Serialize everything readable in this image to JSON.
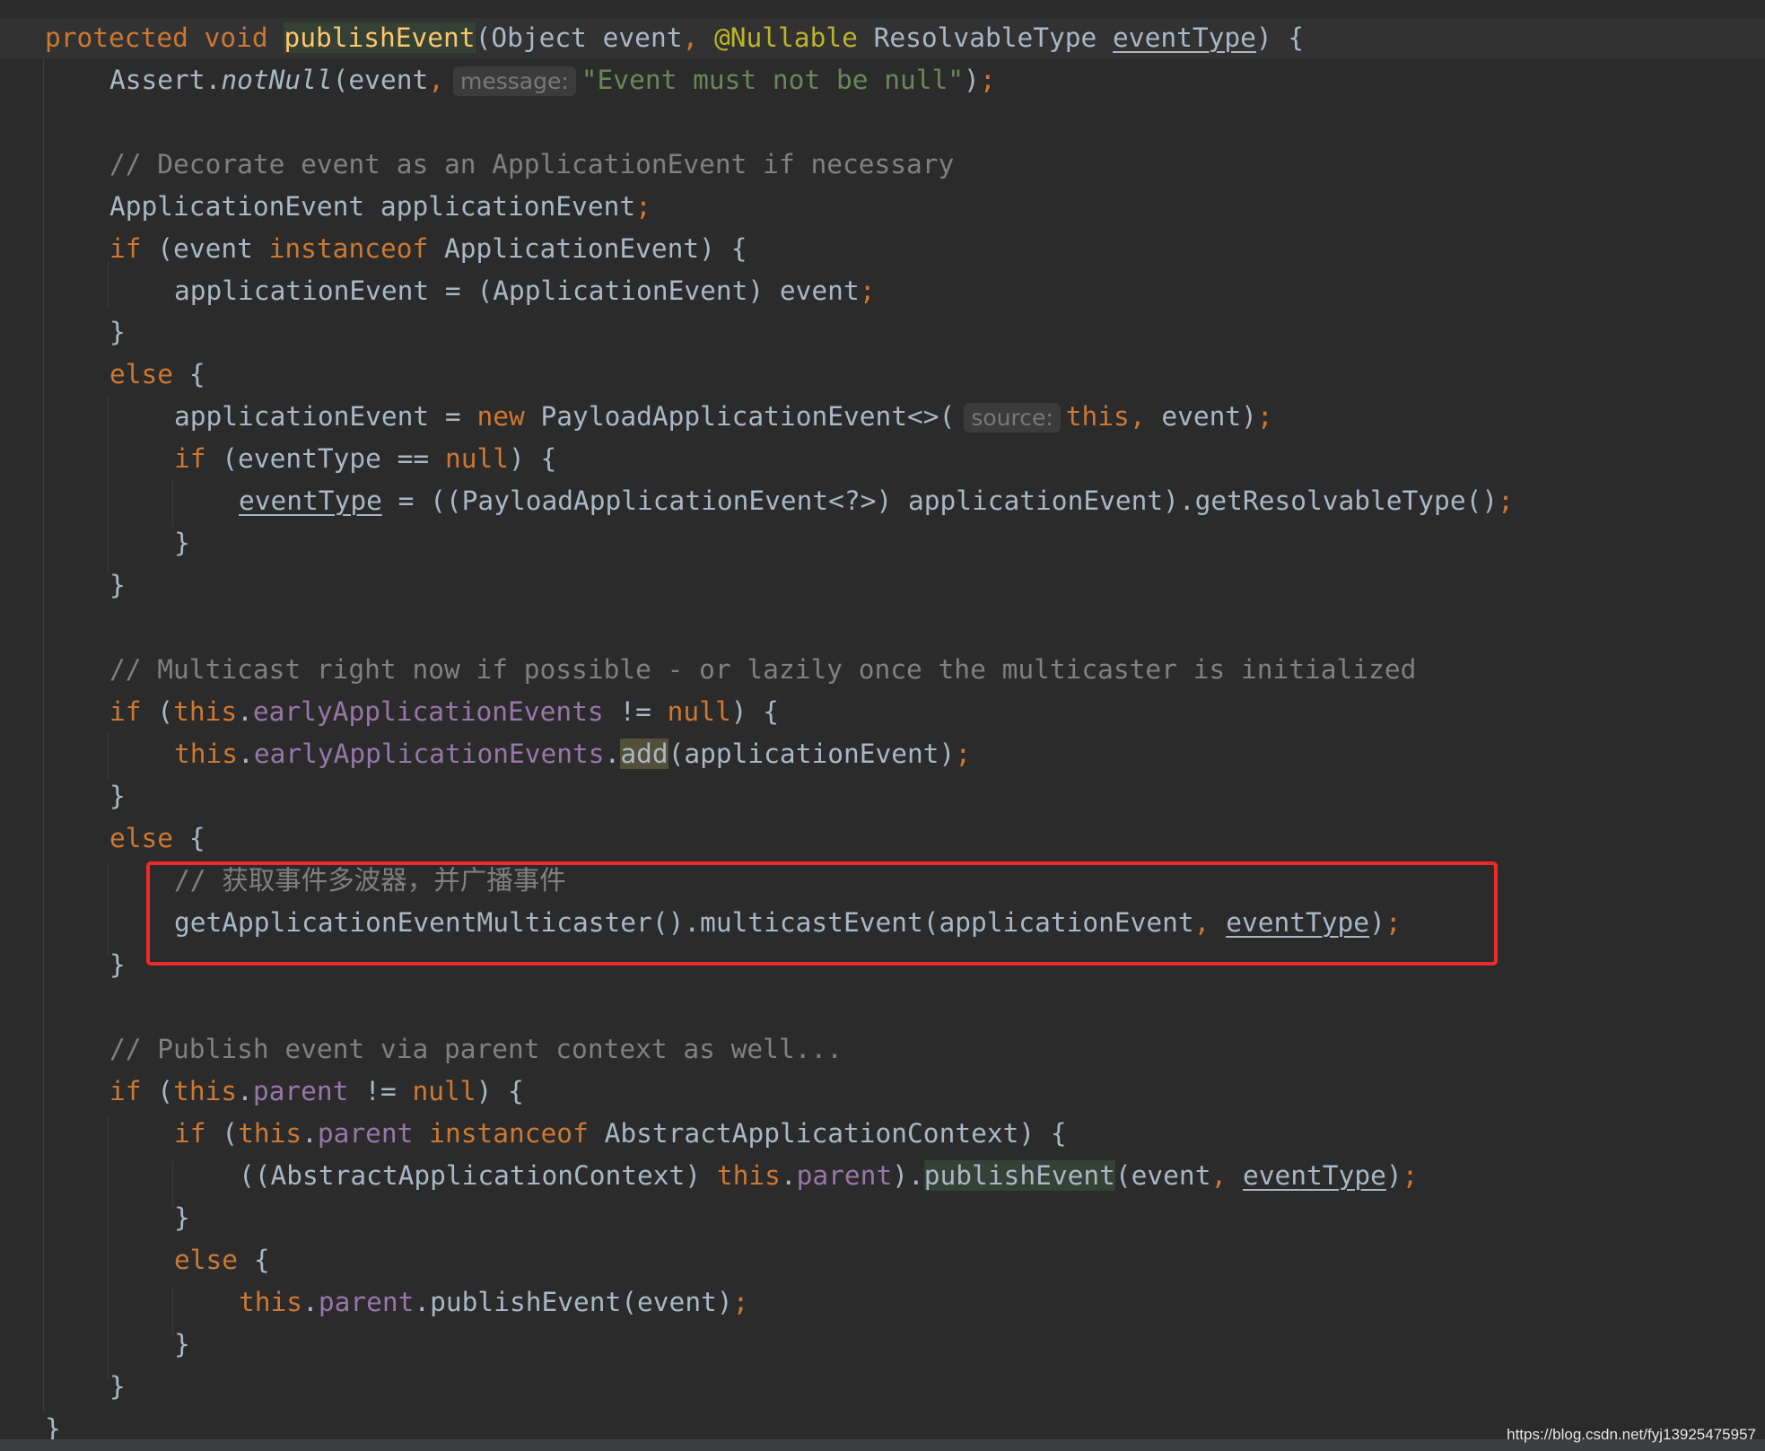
{
  "colors": {
    "background": "#2b2b2b",
    "current_line": "#323232",
    "keyword": "#cc7832",
    "plain": "#a9b7c6",
    "method_declaration": "#ffc66d",
    "annotation": "#bbb529",
    "string": "#6a8759",
    "comment": "#808080",
    "field": "#9876aa",
    "highlight_box": "#ee2a2a"
  },
  "code": {
    "l01": {
      "kw_protected": "protected",
      "kw_void": "void",
      "method": "publishEvent",
      "open": "(Object event",
      "comma": ",",
      "annotation": "@Nullable",
      "type": "ResolvableType",
      "param": "eventType",
      "close": ") {"
    },
    "l02": {
      "cls": "Assert.",
      "method": "notNull",
      "args": "(event",
      "comma": ",",
      "hint": "message:",
      "str": "\"Event must not be null\"",
      "close": ")",
      "semi": ";"
    },
    "l03": {
      "comment": "// Decorate event as an ApplicationEvent if necessary"
    },
    "l04": {
      "decl": "ApplicationEvent applicationEvent",
      "semi": ";"
    },
    "l05": {
      "kw_if": "if",
      "open": "(event",
      "kw_instanceof": "instanceof",
      "rest": "ApplicationEvent) {"
    },
    "l06": {
      "stmt": "applicationEvent = (ApplicationEvent) event",
      "semi": ";"
    },
    "l07": {
      "brace": "}"
    },
    "l08": {
      "kw_else": "else",
      "brace": "{"
    },
    "l09": {
      "lhs": "applicationEvent =",
      "kw_new": "new",
      "ctor": "PayloadApplicationEvent<>(",
      "hint": "source:",
      "kw_this": "this",
      "comma": ",",
      "arg": "event)",
      "semi": ";"
    },
    "l10": {
      "kw_if": "if",
      "open": "(eventType ==",
      "kw_null": "null",
      "close": ") {"
    },
    "l11": {
      "var": "eventType",
      "rest": "= ((PayloadApplicationEvent<?>) applicationEvent).getResolvableType()",
      "semi": ";"
    },
    "l12": {
      "brace": "}"
    },
    "l13": {
      "brace": "}"
    },
    "l14": {
      "comment": "// Multicast right now if possible - or lazily once the multicaster is initialized"
    },
    "l15": {
      "kw_if": "if",
      "open": "(",
      "kw_this": "this",
      "dot": ".",
      "field": "earlyApplicationEvents",
      "op": "!=",
      "kw_null": "null",
      "close": ") {"
    },
    "l16": {
      "kw_this": "this",
      "dot": ".",
      "field": "earlyApplicationEvents",
      "dot2": ".",
      "method": "add",
      "args": "(applicationEvent)",
      "semi": ";"
    },
    "l17": {
      "brace": "}"
    },
    "l18": {
      "kw_else": "else",
      "brace": "{"
    },
    "l19": {
      "comment": "// 获取事件多波器，并广播事件"
    },
    "l20": {
      "call": "getApplicationEventMulticaster().multicastEvent(applicationEvent",
      "comma": ",",
      "var": "eventType",
      "close": ")",
      "semi": ";"
    },
    "l21": {
      "brace": "}"
    },
    "l22": {
      "comment": "// Publish event via parent context as well..."
    },
    "l23": {
      "kw_if": "if",
      "open": "(",
      "kw_this": "this",
      "dot": ".",
      "field": "parent",
      "op": "!=",
      "kw_null": "null",
      "close": ") {"
    },
    "l24": {
      "kw_if": "if",
      "open": "(",
      "kw_this": "this",
      "dot": ".",
      "field": "parent",
      "kw_instanceof": "instanceof",
      "rest": "AbstractApplicationContext) {"
    },
    "l25": {
      "cast": "((AbstractApplicationContext)",
      "kw_this": "this",
      "dot": ".",
      "field": "parent",
      "close_paren": ").",
      "method": "publishEvent",
      "args": "(event",
      "comma": ",",
      "var": "eventType",
      "close": ")",
      "semi": ";"
    },
    "l26": {
      "brace": "}"
    },
    "l27": {
      "kw_else": "else",
      "brace": "{"
    },
    "l28": {
      "kw_this": "this",
      "dot": ".",
      "field": "parent",
      "rest": ".publishEvent(event)",
      "semi": ";"
    },
    "l29": {
      "brace": "}"
    },
    "l30": {
      "brace": "}"
    },
    "l31": {
      "brace": "}"
    }
  },
  "watermark": "https://blog.csdn.net/fyj13925475957"
}
